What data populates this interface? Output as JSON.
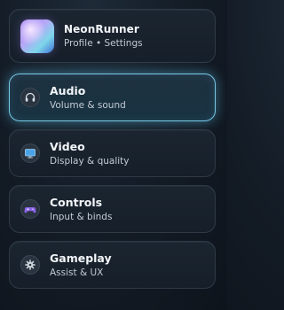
{
  "header": {
    "title": "NeonRunner",
    "subtitle": "Profile • Settings"
  },
  "menu": {
    "items": [
      {
        "label": "Audio",
        "description": "Volume & sound",
        "icon": "headphones-icon",
        "active": true
      },
      {
        "label": "Video",
        "description": "Display & quality",
        "icon": "monitor-icon",
        "active": false
      },
      {
        "label": "Controls",
        "description": "Input & binds",
        "icon": "gamepad-icon",
        "active": false
      },
      {
        "label": "Gameplay",
        "description": "Assist & UX",
        "icon": "gear-icon",
        "active": false
      }
    ]
  },
  "colors": {
    "accent": "#79c9e6",
    "background": "#131b25",
    "card": "#1a232e"
  }
}
